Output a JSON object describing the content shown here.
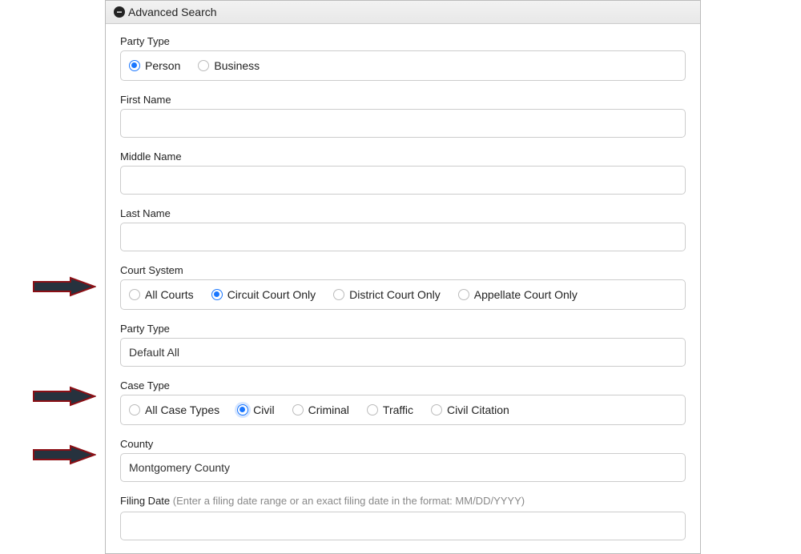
{
  "header": {
    "title": "Advanced Search"
  },
  "partyType1": {
    "label": "Party Type",
    "options": [
      {
        "label": "Person",
        "selected": true
      },
      {
        "label": "Business",
        "selected": false
      }
    ]
  },
  "firstName": {
    "label": "First Name",
    "value": ""
  },
  "middleName": {
    "label": "Middle Name",
    "value": ""
  },
  "lastName": {
    "label": "Last Name",
    "value": ""
  },
  "courtSystem": {
    "label": "Court System",
    "options": [
      {
        "label": "All Courts",
        "selected": false
      },
      {
        "label": "Circuit Court Only",
        "selected": true
      },
      {
        "label": "District Court Only",
        "selected": false
      },
      {
        "label": "Appellate Court Only",
        "selected": false
      }
    ]
  },
  "partyType2": {
    "label": "Party Type",
    "value": "Default All"
  },
  "caseType": {
    "label": "Case Type",
    "options": [
      {
        "label": "All Case Types",
        "selected": false
      },
      {
        "label": "Civil",
        "selected": true
      },
      {
        "label": "Criminal",
        "selected": false
      },
      {
        "label": "Traffic",
        "selected": false
      },
      {
        "label": "Civil Citation",
        "selected": false
      }
    ]
  },
  "county": {
    "label": "County",
    "value": "Montgomery County"
  },
  "filingDate": {
    "label": "Filing Date",
    "hint": "(Enter a filing date range or an exact filing date in the format: MM/DD/YYYY)"
  }
}
